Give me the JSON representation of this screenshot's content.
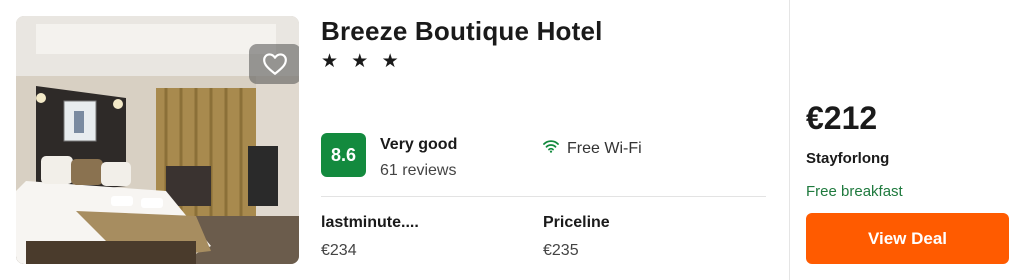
{
  "hotel": {
    "name": "Breeze Boutique Hotel",
    "stars_display": "★ ★ ★",
    "photo_icon": "hotel-room-photo",
    "favorite_icon": "heart-outline-icon"
  },
  "rating": {
    "score": "8.6",
    "label": "Very good",
    "reviews": "61 reviews",
    "badge_color": "#138a3e"
  },
  "amenities": [
    {
      "icon": "wifi-icon",
      "label": "Free Wi-Fi",
      "color": "#138a3e"
    }
  ],
  "other_deals": [
    {
      "provider": "lastminute....",
      "price": "€234"
    },
    {
      "provider": "Priceline",
      "price": "€235"
    }
  ],
  "best_deal": {
    "price": "€212",
    "provider": "Stayforlong",
    "perk": "Free breakfast",
    "button_label": "View Deal",
    "button_color": "#ff5b00",
    "perk_color": "#1f7a3e"
  }
}
